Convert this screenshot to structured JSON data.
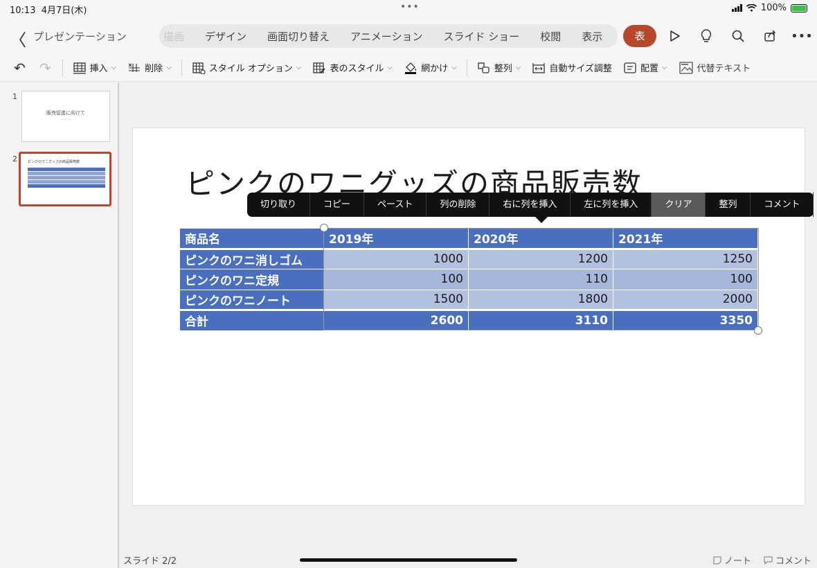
{
  "status": {
    "time": "10:13",
    "date": "4月7日(木)",
    "battery": "100%"
  },
  "topbar": {
    "back_icon": "chevron-left-icon",
    "doc_title": "プレゼンテーション",
    "tabs": [
      "描画",
      "デザイン",
      "画面切り替え",
      "アニメーション",
      "スライド ショー",
      "校閲",
      "表示"
    ],
    "active_tab": "表",
    "icons": [
      "play-icon",
      "lightbulb-icon",
      "search-icon",
      "share-icon",
      "more-icon"
    ]
  },
  "ribbon": {
    "items": [
      {
        "label": "挿入",
        "icon": "table-insert-icon"
      },
      {
        "label": "削除",
        "icon": "table-delete-icon"
      },
      {
        "label": "スタイル オプション",
        "icon": "style-options-icon"
      },
      {
        "label": "表のスタイル",
        "icon": "table-style-icon"
      },
      {
        "label": "網かけ",
        "icon": "shading-icon"
      },
      {
        "label": "整列",
        "icon": "arrange-icon"
      },
      {
        "label": "自動サイズ調整",
        "icon": "autofit-icon"
      },
      {
        "label": "配置",
        "icon": "align-icon"
      },
      {
        "label": "代替テキスト",
        "icon": "alt-text-icon"
      }
    ]
  },
  "thumbnails": {
    "slide1": {
      "number": "1",
      "title": "販売促進に向けて"
    },
    "slide2": {
      "number": "2",
      "title": "ピンクのワニグッズの商品販売数"
    }
  },
  "slide": {
    "title": "ピンクのワニグッズの商品販売数",
    "table": {
      "headers": [
        "商品名",
        "2019年",
        "2020年",
        "2021年"
      ],
      "rows": [
        [
          "ピンクのワニ消しゴム",
          "1000",
          "1200",
          "1250"
        ],
        [
          "ピンクのワニ定規",
          "100",
          "110",
          "100"
        ],
        [
          "ピンクのワニノート",
          "1500",
          "1800",
          "2000"
        ],
        [
          "合計",
          "2600",
          "3110",
          "3350"
        ]
      ]
    }
  },
  "context_menu": {
    "items": [
      "切り取り",
      "コピー",
      "ペースト",
      "列の削除",
      "右に列を挿入",
      "左に列を挿入",
      "クリア",
      "整列",
      "コメント"
    ],
    "highlighted": "クリア"
  },
  "bottom": {
    "slide_count": "スライド 2/2",
    "notes": "ノート",
    "comments": "コメント"
  },
  "colors": {
    "accent": "#b7472a",
    "table_header": "#4b6fbf",
    "table_body": "#b3c1e0"
  }
}
